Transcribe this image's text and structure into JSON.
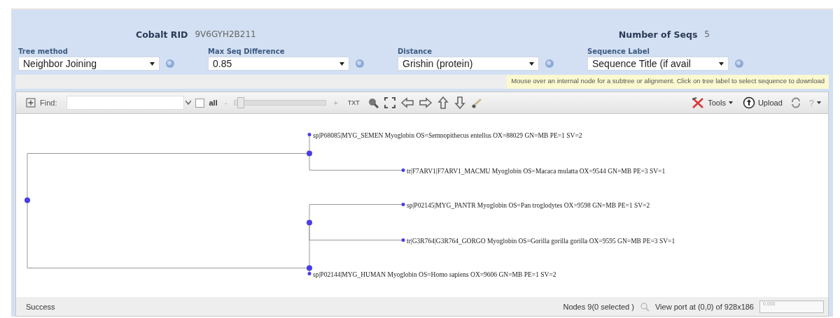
{
  "header": {
    "rid_label": "Cobalt RID",
    "rid_value": "9V6GYH2B211",
    "seqs_label": "Number of Seqs",
    "seqs_value": "5"
  },
  "controls": [
    {
      "label": "Tree method",
      "value": "Neighbor Joining"
    },
    {
      "label": "Max Seq Difference",
      "value": "0.85"
    },
    {
      "label": "Distance",
      "value": "Grishin (protein)"
    },
    {
      "label": "Sequence Label",
      "value": "Sequence Title (if avail"
    }
  ],
  "hint": "Mouse over an internal node for a subtree or alignment. Click on tree label to select sequence to download",
  "toolbar": {
    "find_label": "Find:",
    "all_label": "all",
    "all_checked": false,
    "zoom_out": "-",
    "zoom_in": "+",
    "level": 0.06,
    "txt": "TXT",
    "tools": "Tools",
    "upload": "Upload",
    "help": "?"
  },
  "tree": {
    "children": [
      {
        "children": [
          {
            "label": "sp|P68085|MYG_SEMEN Myoglobin OS=Semnopithecus entellus OX=88029 GN=MB PE=1 SV=2"
          },
          {
            "label": "tr|F7ARV1|F7ARV1_MACMU Myoglobin OS=Macaca mulatta OX=9544 GN=MB PE=3 SV=1"
          }
        ]
      },
      {
        "children": [
          {
            "children": [
              {
                "label": "sp|P02145|MYG_PANTR Myoglobin OS=Pan troglodytes OX=9598 GN=MB PE=1 SV=2"
              },
              {
                "label": "tr|G3R764|G3R764_GORGO Myoglobin OS=Gorilla gorilla gorilla OX=9595 GN=MB PE=3 SV=1"
              }
            ]
          },
          {
            "label": "sp|P02144|MYG_HUMAN Myoglobin OS=Homo sapiens OX=9606 GN=MB PE=1 SV=2"
          }
        ]
      }
    ]
  },
  "status": {
    "message": "Success",
    "nodes": "Nodes 9(0 selected )",
    "viewport": "View port at (0,0)  of 928x186",
    "mini_value": "0.000"
  }
}
